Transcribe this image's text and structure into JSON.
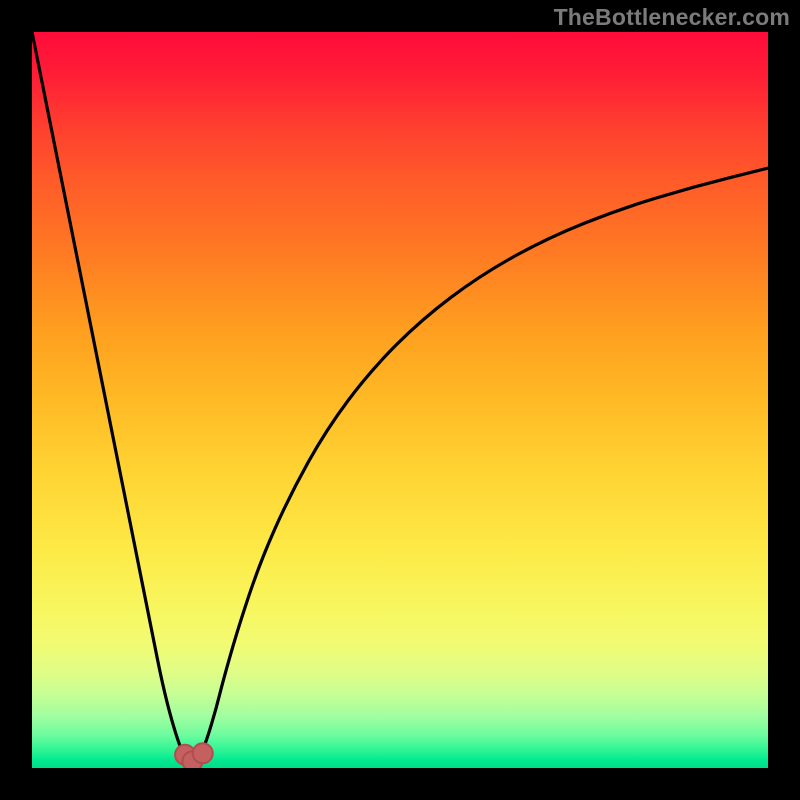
{
  "watermark": {
    "text": "TheBottlenecker.com"
  },
  "colors": {
    "frame": "#000000",
    "curve": "#000000",
    "marker_fill": "#c56060",
    "marker_stroke": "#b24d4d",
    "gradient_top": "#ff0b3a",
    "gradient_bottom": "#00db89"
  },
  "chart_data": {
    "type": "line",
    "title": "",
    "xlabel": "",
    "ylabel": "",
    "xlim": [
      0,
      1
    ],
    "ylim": [
      0,
      1
    ],
    "legend": "none",
    "grid": false,
    "annotations": [],
    "series": [
      {
        "name": "bottleneck-curve",
        "x": [
          0.0,
          0.02,
          0.04,
          0.06,
          0.08,
          0.1,
          0.12,
          0.14,
          0.16,
          0.18,
          0.2,
          0.21,
          0.215,
          0.22,
          0.225,
          0.23,
          0.238,
          0.25,
          0.26,
          0.28,
          0.31,
          0.35,
          0.4,
          0.46,
          0.53,
          0.61,
          0.7,
          0.8,
          0.9,
          1.0
        ],
        "y": [
          1.0,
          0.9,
          0.8,
          0.7,
          0.6,
          0.5,
          0.4,
          0.3,
          0.2,
          0.1,
          0.03,
          0.013,
          0.01,
          0.01,
          0.012,
          0.02,
          0.04,
          0.08,
          0.12,
          0.19,
          0.28,
          0.37,
          0.46,
          0.54,
          0.61,
          0.67,
          0.72,
          0.76,
          0.79,
          0.815
        ]
      }
    ],
    "markers": [
      {
        "name": "valley-left",
        "x": 0.208,
        "y": 0.018
      },
      {
        "name": "valley-bottom",
        "x": 0.218,
        "y": 0.009
      },
      {
        "name": "valley-right",
        "x": 0.232,
        "y": 0.02
      }
    ]
  }
}
